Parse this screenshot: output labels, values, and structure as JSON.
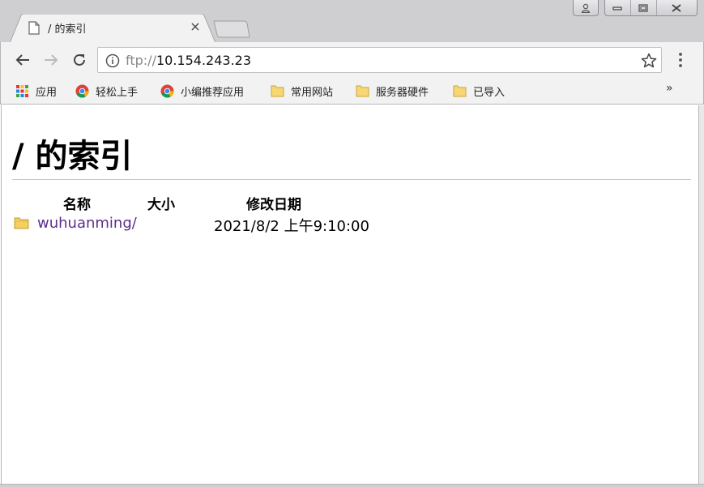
{
  "window": {
    "user_icon": "user-icon",
    "minimize_icon": "minimize-icon",
    "maximize_icon": "maximize-icon",
    "close_icon": "close-icon"
  },
  "tab": {
    "title": "/ 的索引",
    "close_label": "×",
    "icon": "document-icon"
  },
  "toolbar": {
    "url_scheme": "ftp://",
    "url_host": "10.154.243.23"
  },
  "bookmarks": {
    "items": [
      {
        "label": "应用",
        "icon": "apps-grid-icon"
      },
      {
        "label": "轻松上手",
        "icon": "chrome-icon"
      },
      {
        "label": "小编推荐应用",
        "icon": "chrome-icon"
      },
      {
        "label": "常用网站",
        "icon": "folder-icon"
      },
      {
        "label": "服务器硬件",
        "icon": "folder-icon"
      },
      {
        "label": "已导入",
        "icon": "folder-icon"
      }
    ],
    "more_label": "»"
  },
  "page": {
    "title": "/ 的索引",
    "columns": [
      "名称",
      "大小",
      "修改日期"
    ],
    "rows": [
      {
        "name": "wuhuanming/",
        "size": "",
        "modified": "2021/8/2 上午9:10:00"
      }
    ]
  },
  "colors": {
    "link_visited": "#5a2f8c",
    "chrome_frame": "#cfcfd2",
    "toolbar_bg": "#f2f2f2"
  }
}
